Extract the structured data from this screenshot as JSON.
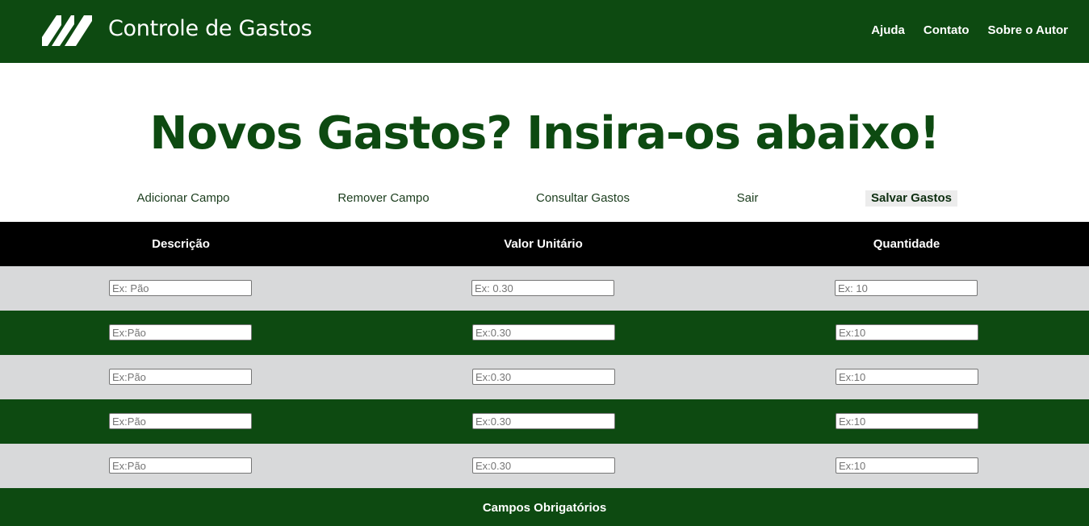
{
  "header": {
    "brand": "Controle de Gastos",
    "nav": [
      "Ajuda",
      "Contato",
      "Sobre o Autor"
    ]
  },
  "hero": {
    "title": "Novos Gastos? Insira-os abaixo!"
  },
  "actions": {
    "add_field": "Adicionar Campo",
    "remove_field": "Remover Campo",
    "consult": "Consultar Gastos",
    "exit": "Sair",
    "save": "Salvar Gastos"
  },
  "table": {
    "headers": [
      "Descrição",
      "Valor Unitário",
      "Quantidade"
    ],
    "rows": [
      {
        "description_placeholder": "Ex: Pão",
        "value_placeholder": "Ex: 0.30",
        "quantity_placeholder": "Ex: 10"
      },
      {
        "description_placeholder": "Ex:Pão",
        "value_placeholder": "Ex:0.30",
        "quantity_placeholder": "Ex:10"
      },
      {
        "description_placeholder": "Ex:Pão",
        "value_placeholder": "Ex:0.30",
        "quantity_placeholder": "Ex:10"
      },
      {
        "description_placeholder": "Ex:Pão",
        "value_placeholder": "Ex:0.30",
        "quantity_placeholder": "Ex:10"
      },
      {
        "description_placeholder": "Ex:Pão",
        "value_placeholder": "Ex:0.30",
        "quantity_placeholder": "Ex:10"
      }
    ]
  },
  "footer": {
    "required_note": "Campos Obrigatórios"
  },
  "colors": {
    "brand_green": "#0d4a11",
    "row_light": "#d8d9da",
    "table_header": "#000000"
  },
  "icons": {
    "logo": "stripes-logo-icon"
  }
}
